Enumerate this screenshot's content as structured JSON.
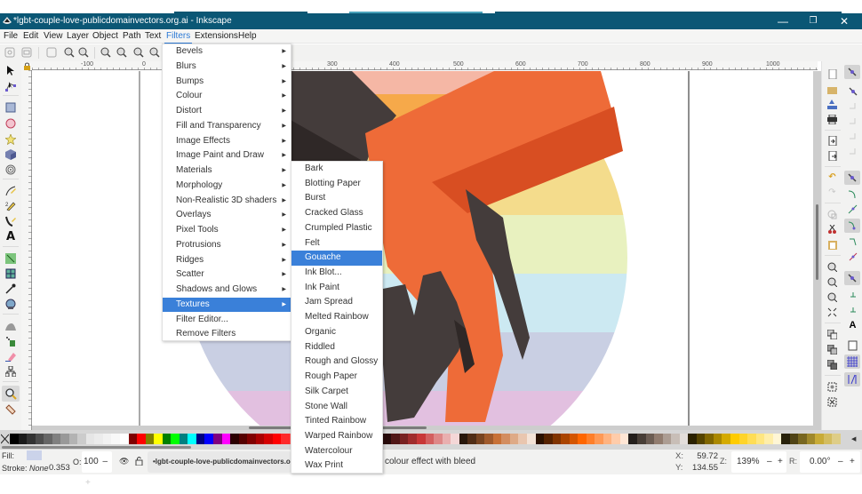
{
  "window": {
    "title": "*lgbt-couple-love-publicdomainvectors.org.ai - Inkscape",
    "controls": {
      "minimize": "—",
      "maximize": "❐",
      "close": "✕"
    }
  },
  "menubar": {
    "items": [
      "File",
      "Edit",
      "View",
      "Layer",
      "Object",
      "Path",
      "Text",
      "Filters",
      "Extensions",
      "Help"
    ],
    "active": "Filters"
  },
  "rulers": {
    "top_labels": [
      "-100",
      "0",
      "300",
      "400",
      "500",
      "600",
      "700",
      "800",
      "900",
      "1000"
    ]
  },
  "filters_menu": {
    "items": [
      {
        "label": "Bevels",
        "submenu": true
      },
      {
        "label": "Blurs",
        "submenu": true
      },
      {
        "label": "Bumps",
        "submenu": true
      },
      {
        "label": "Colour",
        "submenu": true
      },
      {
        "label": "Distort",
        "submenu": true
      },
      {
        "label": "Fill and Transparency",
        "submenu": true
      },
      {
        "label": "Image Effects",
        "submenu": true
      },
      {
        "label": "Image Paint and Draw",
        "submenu": true
      },
      {
        "label": "Materials",
        "submenu": true
      },
      {
        "label": "Morphology",
        "submenu": true
      },
      {
        "label": "Non-Realistic 3D shaders",
        "submenu": true
      },
      {
        "label": "Overlays",
        "submenu": true
      },
      {
        "label": "Pixel Tools",
        "submenu": true
      },
      {
        "label": "Protrusions",
        "submenu": true
      },
      {
        "label": "Ridges",
        "submenu": true
      },
      {
        "label": "Scatter",
        "submenu": true
      },
      {
        "label": "Shadows and Glows",
        "submenu": true
      },
      {
        "label": "Textures",
        "submenu": true,
        "highlighted": true
      },
      {
        "label": "Filter Editor...",
        "submenu": false
      },
      {
        "label": "Remove Filters",
        "submenu": false
      }
    ]
  },
  "textures_menu": {
    "items": [
      {
        "label": "Bark"
      },
      {
        "label": "Blotting Paper"
      },
      {
        "label": "Burst"
      },
      {
        "label": "Cracked Glass"
      },
      {
        "label": "Crumpled Plastic"
      },
      {
        "label": "Felt"
      },
      {
        "label": "Gouache",
        "highlighted": true
      },
      {
        "label": "Ink Blot..."
      },
      {
        "label": "Ink Paint"
      },
      {
        "label": "Jam Spread"
      },
      {
        "label": "Melted Rainbow"
      },
      {
        "label": "Organic"
      },
      {
        "label": "Riddled"
      },
      {
        "label": "Rough and Glossy"
      },
      {
        "label": "Rough Paper"
      },
      {
        "label": "Silk Carpet"
      },
      {
        "label": "Stone Wall"
      },
      {
        "label": "Tinted Rainbow"
      },
      {
        "label": "Warped Rainbow"
      },
      {
        "label": "Watercolour"
      },
      {
        "label": "Wax Print"
      }
    ]
  },
  "toolbox": {
    "tools": [
      "selector-tool",
      "node-tool",
      "rectangle-tool",
      "ellipse-tool",
      "star-tool",
      "3d-box-tool",
      "spiral-tool",
      "pencil-tool",
      "pen-tool",
      "calligraphy-tool",
      "text-tool",
      "gradient-tool",
      "mesh-tool",
      "dropper-tool",
      "paint-bucket-tool",
      "tweak-tool",
      "spray-tool",
      "eraser-tool",
      "connector-tool",
      "zoom-tool",
      "measure-tool"
    ],
    "active": "zoom-tool"
  },
  "palette": {
    "colors": [
      "#000000",
      "#1a1a1a",
      "#333333",
      "#4d4d4d",
      "#666666",
      "#808080",
      "#999999",
      "#b3b3b3",
      "#cccccc",
      "#e6e6e6",
      "#ececec",
      "#f2f2f2",
      "#f8f8f8",
      "#ffffff",
      "#800000",
      "#ff0000",
      "#808000",
      "#ffff00",
      "#008000",
      "#00ff00",
      "#008080",
      "#00ffff",
      "#000080",
      "#0000ff",
      "#800080",
      "#ff00ff",
      "#2b0000",
      "#550000",
      "#800000",
      "#aa0000",
      "#d40000",
      "#ff0000",
      "#ff2a2a",
      "#ff5555",
      "#ff8080",
      "#ffaaaa",
      "#ffd5d5",
      "#241c1c",
      "#483737",
      "#6c5353",
      "#916f6f",
      "#ac9393",
      "#c8b7b7",
      "#e3dbdb",
      "#280b0b",
      "#501616",
      "#782121",
      "#a02c2c",
      "#c83737",
      "#d35f5f",
      "#de8787",
      "#e9afaf",
      "#f4d7d7",
      "#28170b",
      "#502d16",
      "#784421",
      "#a05a2c",
      "#c87137",
      "#d38d5f",
      "#deaa87",
      "#e9c6af",
      "#f4e3d7",
      "#2b1100",
      "#552200",
      "#803300",
      "#aa4400",
      "#d45500",
      "#ff6600",
      "#ff7f2a",
      "#ff9955",
      "#ffb380",
      "#ffccaa",
      "#ffe6d5",
      "#241f1c",
      "#483e37",
      "#6c5d53",
      "#917c6f",
      "#ac9d93",
      "#c8beb7",
      "#e3dedb",
      "#2b2200",
      "#554400",
      "#806600",
      "#aa8800",
      "#d4aa00",
      "#ffcc00",
      "#ffd42a",
      "#ffdd55",
      "#ffe680",
      "#ffeeaa",
      "#fff6d5",
      "#28220b",
      "#504416",
      "#786721",
      "#a0892c",
      "#c8ab37",
      "#d3bc5f",
      "#decd87"
    ]
  },
  "status": {
    "fill_label": "Fill:",
    "fill_color": "#cbd3ea",
    "stroke_label": "Stroke:",
    "stroke_value": "None",
    "stroke_width": "0.353",
    "opacity_label": "O:",
    "opacity_value": "100",
    "opacity_minus": "–",
    "opacity_plus": "+",
    "layer_name": "•lgbt-couple-love-publicdomainvectors.org",
    "message": "colour effect with bleed",
    "x_label": "X:",
    "x_value": "59.72",
    "y_label": "Y:",
    "y_value": "134.55",
    "zoom_label": "Z:",
    "zoom_value": "139%",
    "rotate_label": "R:",
    "rotate_value": "0.00°",
    "minus": "–",
    "plus": "+"
  },
  "artwork": {
    "stripes": [
      "#f5b7a5",
      "#f6a94a",
      "#f4dc8c",
      "#e8f1bf",
      "#cce9f2",
      "#c9cfe3",
      "#e2c0e0"
    ],
    "hand_orange": "#ee6b38",
    "hand_orange_dark": "#d84e22",
    "sleeve_dark": "#443c3b",
    "sleeve_darker": "#2f2827"
  }
}
